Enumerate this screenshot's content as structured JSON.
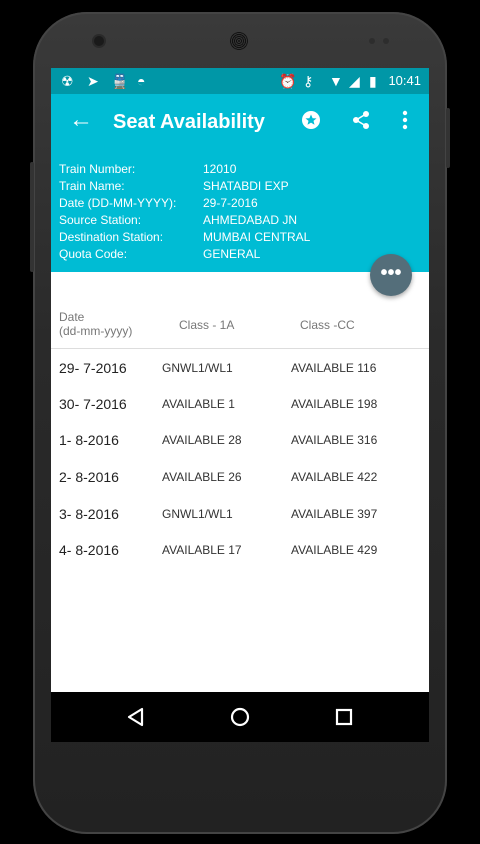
{
  "status_bar": {
    "icons_left": [
      "bug-icon",
      "send-icon",
      "train-icon",
      "android-icon"
    ],
    "icons_right": [
      "alarm-icon",
      "key-icon",
      "wifi-icon",
      "signal-icon",
      "battery-icon"
    ],
    "time": "10:41"
  },
  "app_bar": {
    "title": "Seat Availability",
    "actions": [
      "star-icon",
      "share-icon",
      "more-vert-icon"
    ]
  },
  "train_info": [
    {
      "label": "Train Number:",
      "value": "12010"
    },
    {
      "label": "Train Name:",
      "value": "SHATABDI EXP"
    },
    {
      "label": "Date (DD-MM-YYYY):",
      "value": "29-7-2016"
    },
    {
      "label": "Source Station:",
      "value": "AHMEDABAD JN"
    },
    {
      "label": "Destination Station:",
      "value": "MUMBAI CENTRAL"
    },
    {
      "label": "Quota Code:",
      "value": "GENERAL"
    }
  ],
  "fab": {
    "label": "•••"
  },
  "table": {
    "headers": {
      "date_line1": "Date",
      "date_line2": "(dd-mm-yyyy)",
      "class1": "Class - 1A",
      "class2": "Class -CC"
    },
    "rows": [
      {
        "date": "29- 7-2016",
        "class1": "GNWL1/WL1",
        "class2": "AVAILABLE 116"
      },
      {
        "date": "30- 7-2016",
        "class1": "AVAILABLE 1",
        "class2": "AVAILABLE 198"
      },
      {
        "date": "1- 8-2016",
        "class1": "AVAILABLE 28",
        "class2": "AVAILABLE 316"
      },
      {
        "date": "2- 8-2016",
        "class1": "AVAILABLE 26",
        "class2": "AVAILABLE 422"
      },
      {
        "date": "3- 8-2016",
        "class1": "GNWL1/WL1",
        "class2": "AVAILABLE 397"
      },
      {
        "date": "4- 8-2016",
        "class1": "AVAILABLE 17",
        "class2": "AVAILABLE 429"
      }
    ]
  },
  "nav_bar": [
    "back-nav-icon",
    "home-nav-icon",
    "recents-nav-icon"
  ],
  "colors": {
    "primary": "#00bcd4",
    "primary_dark": "#0097a7",
    "fab": "#546e7a"
  }
}
